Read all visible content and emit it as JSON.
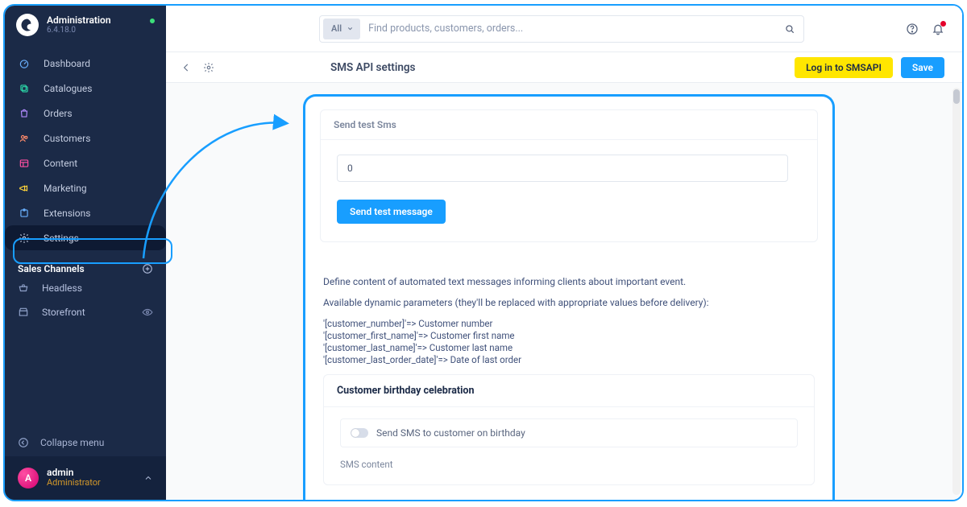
{
  "sidebar": {
    "title": "Administration",
    "version": "6.4.18.0",
    "items": [
      {
        "label": "Dashboard"
      },
      {
        "label": "Catalogues"
      },
      {
        "label": "Orders"
      },
      {
        "label": "Customers"
      },
      {
        "label": "Content"
      },
      {
        "label": "Marketing"
      },
      {
        "label": "Extensions"
      },
      {
        "label": "Settings"
      }
    ],
    "channels_title": "Sales Channels",
    "channels": [
      {
        "label": "Headless"
      },
      {
        "label": "Storefront"
      }
    ],
    "collapse": "Collapse menu",
    "user_name": "admin",
    "user_role": "Administrator",
    "avatar_initial": "A"
  },
  "topbar": {
    "search_chip": "All",
    "search_placeholder": "Find products, customers, orders..."
  },
  "page": {
    "title": "SMS API settings",
    "btn_login": "Log in to SMSAPI",
    "btn_save": "Save"
  },
  "test_card": {
    "title": "Send test Sms",
    "input_value": "0",
    "button": "Send test message"
  },
  "templates": {
    "intro": "Define content of automated text messages informing clients about important event.",
    "available": "Available dynamic parameters (they'll be replaced with appropriate values before delivery):",
    "params": [
      "'[customer_number]'=> Customer number",
      "'[customer_first_name]'=> Customer first name",
      "'[customer_last_name]'=> Customer last name",
      "'[customer_last_order_date]'=> Date of last order"
    ],
    "birthday_title": "Customer birthday celebration",
    "birthday_toggle_label": "Send SMS to customer on birthday",
    "sms_content_label": "SMS content"
  }
}
